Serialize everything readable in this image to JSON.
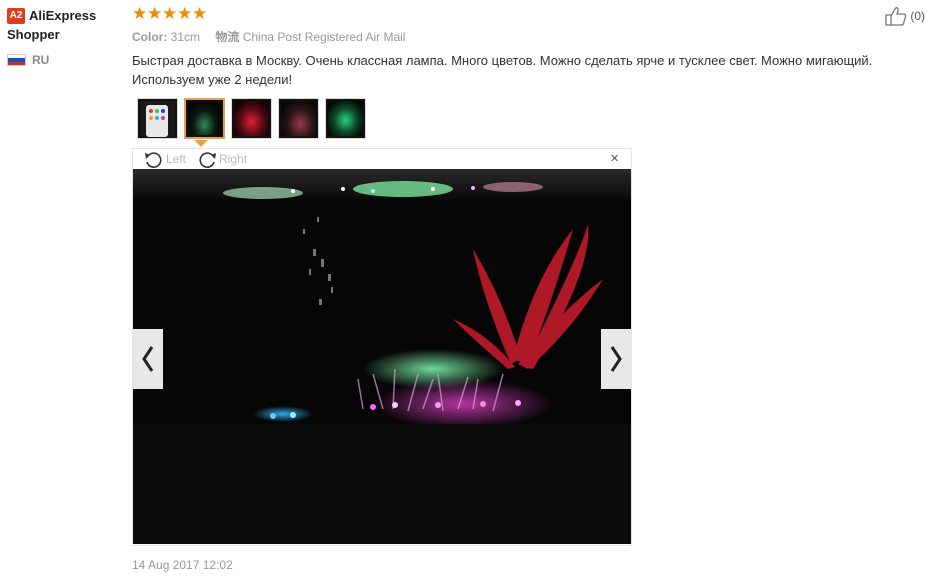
{
  "user": {
    "badge": "A2",
    "name_line1": "AliExpress",
    "name_line2": "Shopper",
    "country": "RU"
  },
  "review": {
    "rating": 5,
    "color_label": "Color:",
    "color_value": "31cm",
    "shipping_label": "物流",
    "shipping_value": "China Post Registered Air Mail",
    "text": "Быстрая доставка в Москву. Очень классная лампа. Много цветов. Можно сделать ярче и тусклее свет. Можно мигающий. Используем уже 2 недели!",
    "date": "14 Aug 2017 12:02",
    "helpful_count": "(0)"
  },
  "viewer": {
    "rotate_left_label": "Left",
    "rotate_right_label": "Right",
    "close_symbol": "×"
  },
  "thumbnails": [
    {
      "name": "remote-photo",
      "active": false
    },
    {
      "name": "aquarium-green-photo",
      "active": true
    },
    {
      "name": "aquarium-red-photo",
      "active": false
    },
    {
      "name": "aquarium-dim-photo",
      "active": false
    },
    {
      "name": "aquarium-green-2-photo",
      "active": false
    }
  ],
  "colors": {
    "star": "#f08a00",
    "badge": "#e03b21",
    "active_thumb_border": "#e9a04a"
  }
}
